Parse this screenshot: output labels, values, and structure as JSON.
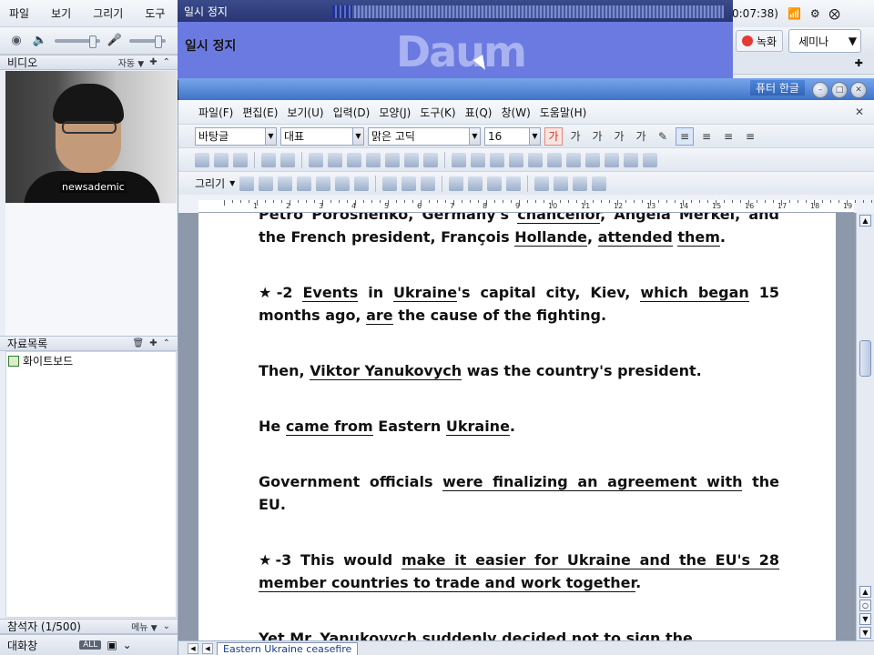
{
  "app": {
    "menu": [
      "파일",
      "보기",
      "그리기",
      "도구"
    ],
    "status_time": "0:07:38)",
    "record_label": "녹화",
    "seminar_label": "세미나",
    "video_panel": {
      "title": "비디오",
      "mode": "자동"
    },
    "video_caption": "newsademic",
    "materials_panel": {
      "title": "자료목록",
      "items": [
        "화이트보드"
      ]
    },
    "participants": {
      "title": "참석자 (1/500)",
      "menu_label": "메뉴"
    },
    "chat_panel": {
      "title": "대화창",
      "all_label": "ALL"
    }
  },
  "player": {
    "title": "일시 정지",
    "screen_status": "일시 정지",
    "logo": "Daum",
    "seek_fraction": 0.38,
    "volume_fraction": 0.6
  },
  "hwp": {
    "app_title_fragment": "퓨터 한글",
    "menu": [
      "파일(F)",
      "편집(E)",
      "보기(U)",
      "입력(D)",
      "모양(J)",
      "도구(K)",
      "표(Q)",
      "창(W)",
      "도움말(H)"
    ],
    "style_combo": "바탕글",
    "lang_combo": "대표",
    "font_combo": "맑은 고딕",
    "size_combo": "16",
    "draw_label": "그리기",
    "ruler_numbers": [
      "1",
      "2",
      "3",
      "4",
      "5",
      "6",
      "7",
      "8",
      "9",
      "10",
      "11",
      "12",
      "13",
      "14",
      "15",
      "16",
      "17",
      "18",
      "19"
    ],
    "doc_tab": "Eastern Ukraine ceasefire",
    "paragraphs": [
      [
        {
          "t": "Petro Poroshenko, Germany's "
        },
        {
          "t": "chancellor",
          "u": true
        },
        {
          "t": ", Angela Merkel, and the French president, François "
        },
        {
          "t": "Hollande",
          "u": true
        },
        {
          "t": ", "
        },
        {
          "t": "attended",
          "u": true
        },
        {
          "t": " "
        },
        {
          "t": "them",
          "u": true
        },
        {
          "t": "."
        }
      ],
      [
        {
          "t": "★-2 "
        },
        {
          "t": "Events",
          "u": true
        },
        {
          "t": " in "
        },
        {
          "t": "Ukraine",
          "u": true
        },
        {
          "t": "'s capital city, Kiev, "
        },
        {
          "t": "which began",
          "u": true
        },
        {
          "t": " 15 months ago, "
        },
        {
          "t": "are",
          "u": true
        },
        {
          "t": " the cause of the fighting."
        }
      ],
      [
        {
          "t": "Then, "
        },
        {
          "t": "Viktor Yanukovych",
          "u": true
        },
        {
          "t": " was the country's president."
        }
      ],
      [
        {
          "t": "He "
        },
        {
          "t": "came from",
          "u": true
        },
        {
          "t": " Eastern "
        },
        {
          "t": "Ukraine",
          "u": true
        },
        {
          "t": "."
        }
      ],
      [
        {
          "t": "Government officials "
        },
        {
          "t": "were finalizing an agreement with",
          "u": true
        },
        {
          "t": " the EU."
        }
      ],
      [
        {
          "t": "★-3 This would "
        },
        {
          "t": "make it easier for Ukraine and the EU's 28 member countries to trade and work together",
          "u": true
        },
        {
          "t": "."
        }
      ],
      [
        {
          "t": "Yet Mr. "
        },
        {
          "t": "Yanukovych",
          "u": true
        },
        {
          "t": " suddenly "
        },
        {
          "t": "decided not to",
          "u": true
        },
        {
          "t": " "
        },
        {
          "t": "sign the",
          "u": true
        }
      ]
    ]
  }
}
